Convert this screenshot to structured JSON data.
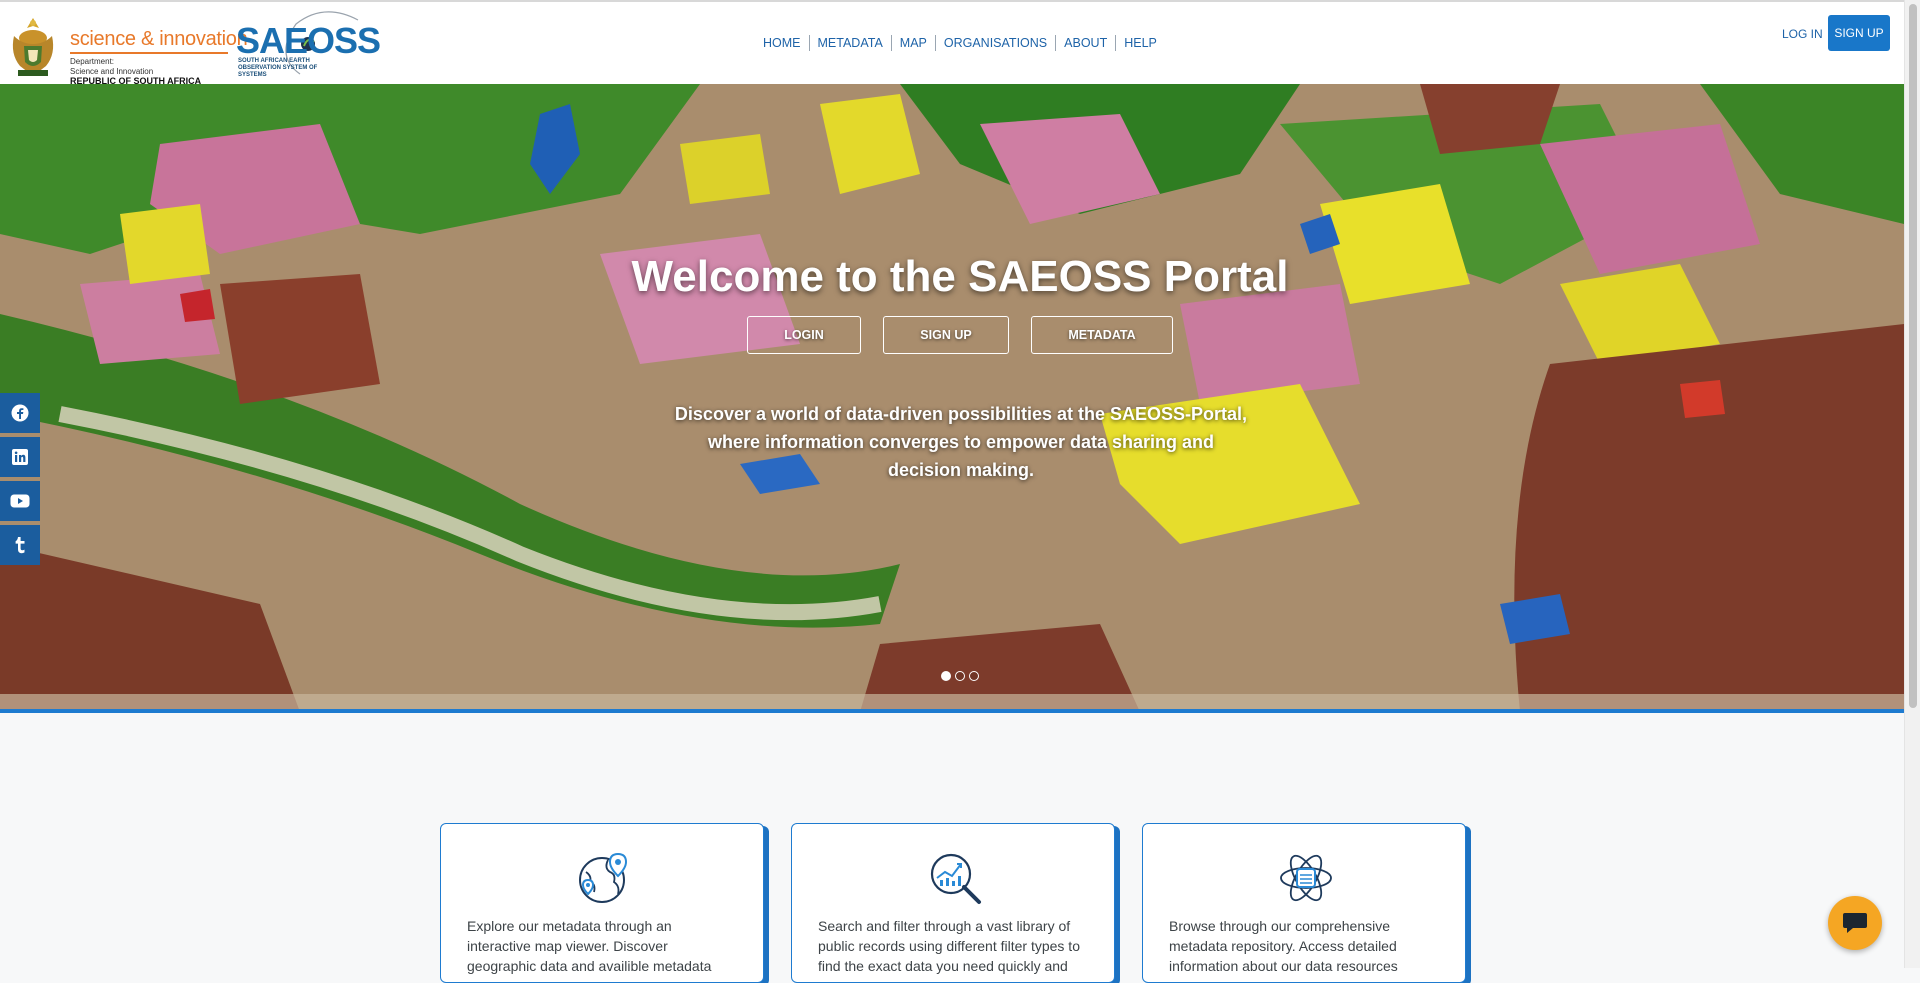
{
  "header": {
    "gov_logo": {
      "title": "science & innovation",
      "department_lines": [
        "Department:",
        "Science and Innovation"
      ],
      "country": "REPUBLIC OF SOUTH AFRICA"
    },
    "saeoss_logo": {
      "wordmark": "SAEOSS",
      "subtitle": "SOUTH AFRICAN EARTH OBSERVATION SYSTEM OF SYSTEMS"
    },
    "nav": [
      "HOME",
      "METADATA",
      "MAP",
      "ORGANISATIONS",
      "ABOUT",
      "HELP"
    ],
    "login_label": "LOG IN",
    "signup_label": "SIGN UP"
  },
  "hero": {
    "title": "Welcome to the SAEOSS Portal",
    "buttons": [
      "LOGIN",
      "SIGN UP",
      "METADATA"
    ],
    "subtitle": "Discover a world of data-driven possibilities at the SAEOSS-Portal, where information converges to empower data sharing and decision making.",
    "slides_total": 3,
    "active_slide": 1
  },
  "social": [
    "facebook-icon",
    "linkedin-icon",
    "youtube-icon",
    "tumblr-icon"
  ],
  "cards": [
    {
      "icon": "globe-map-pin-icon",
      "text": "Explore our metadata through an interactive map viewer. Discover geographic data and availible metadata"
    },
    {
      "icon": "magnifier-chart-icon",
      "text": "Search and filter through a vast library of public records using different filter types to find the exact data you need quickly and"
    },
    {
      "icon": "atom-database-icon",
      "text": "Browse through our comprehensive metadata repository. Access detailed information about our data resources"
    }
  ],
  "colors": {
    "brand_blue": "#1977c9",
    "nav_blue": "#1e63a8",
    "gov_orange": "#e8792a",
    "chat_orange": "#f5a623"
  }
}
